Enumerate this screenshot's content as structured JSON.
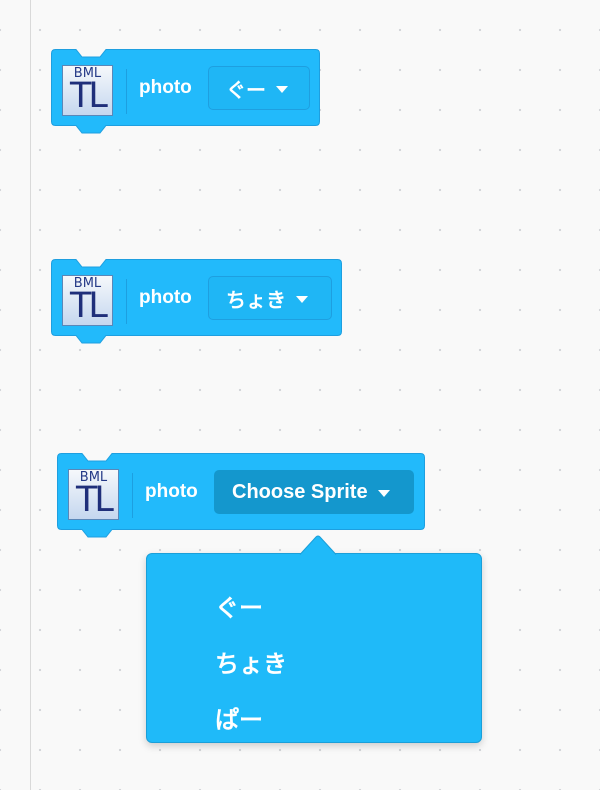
{
  "workspace": {
    "blocks": [
      {
        "icon": {
          "name": "extension-icon",
          "top": "BML",
          "bottom": "TL"
        },
        "label": "photo",
        "dropdown_value": "ぐー"
      },
      {
        "icon": {
          "name": "extension-icon",
          "top": "BML",
          "bottom": "TL"
        },
        "label": "photo",
        "dropdown_value": "ちょき"
      },
      {
        "icon": {
          "name": "extension-icon",
          "top": "BML",
          "bottom": "TL"
        },
        "label": "photo",
        "dropdown_value": "Choose Sprite",
        "dropdown_open": true
      }
    ],
    "dropdown_menu": {
      "items": [
        "ぐー",
        "ちょき",
        "ぱー"
      ]
    }
  },
  "colors": {
    "block_fill": "#22bafb",
    "block_border": "#1e9fe0",
    "field_open": "#1497cd",
    "menu_fill": "#1fbaf9",
    "text": "#ffffff",
    "background": "#f9f9f9"
  }
}
